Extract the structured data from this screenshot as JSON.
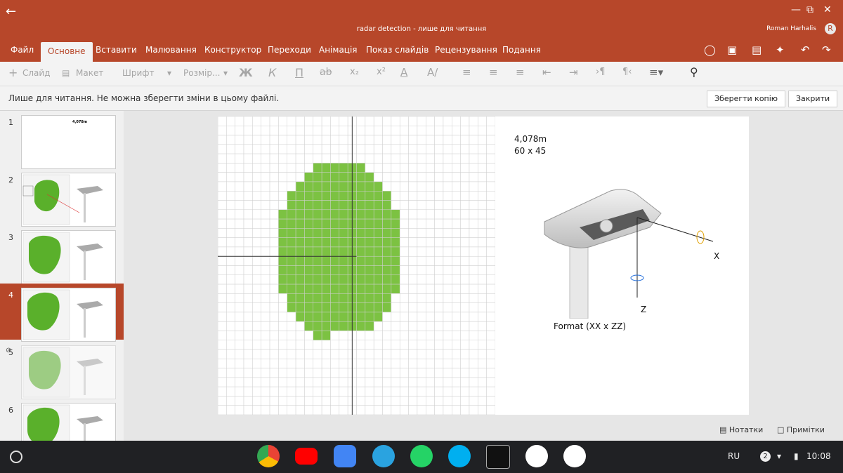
{
  "window": {
    "title": "radar detection - лише для читання",
    "user": "Roman Harhalis",
    "user_initial": "R"
  },
  "tabs": [
    {
      "label": "Файл"
    },
    {
      "label": "Основне"
    },
    {
      "label": "Вставити"
    },
    {
      "label": "Малювання"
    },
    {
      "label": "Конструктор"
    },
    {
      "label": "Переходи"
    },
    {
      "label": "Анімація"
    },
    {
      "label": "Показ слайдів"
    },
    {
      "label": "Рецензування"
    },
    {
      "label": "Подання"
    }
  ],
  "toolbar": {
    "new_slide": "Слайд",
    "layout": "Макет",
    "font": "Шрифт",
    "size": "Розмір..."
  },
  "message": {
    "text": "Лише для читання. Не можна зберегти зміни в цьому файлі.",
    "save_copy": "Зберегти копію",
    "close": "Закрити"
  },
  "thumbnails": [
    {
      "num": "1",
      "title": "4,078m"
    },
    {
      "num": "2"
    },
    {
      "num": "3"
    },
    {
      "num": "4"
    },
    {
      "num": "5"
    },
    {
      "num": "6"
    }
  ],
  "slide": {
    "title_line1": "4,078m",
    "title_line2": "60 x 45",
    "x_label": "X",
    "z_label": "Z",
    "caption": "Format (XX x ZZ)"
  },
  "bottom": {
    "notes": "Нотатки",
    "comments": "Примітки"
  },
  "shelf": {
    "lang": "RU",
    "notifications": "2",
    "time": "10:08"
  },
  "colors": {
    "accent": "#b7472a",
    "green": "#7cc242"
  }
}
